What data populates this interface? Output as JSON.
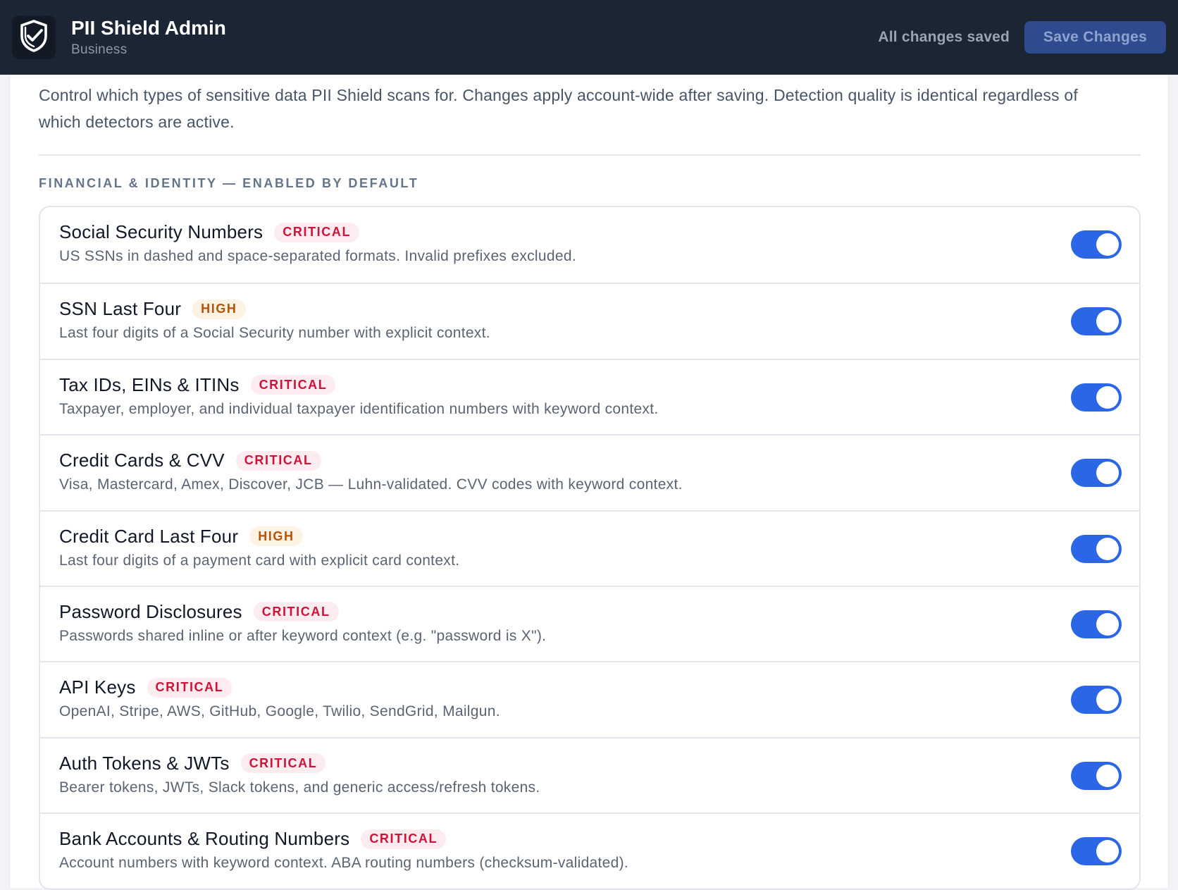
{
  "header": {
    "app_title": "PII Shield Admin",
    "plan_label": "Business",
    "logo_icon": "shield-check-icon",
    "save_status": "All changes saved",
    "save_button_label": "Save Changes"
  },
  "intro_text": "Control which types of sensitive data PII Shield scans for. Changes apply account-wide after saving. Detection quality is identical regardless of which detectors are active.",
  "section": {
    "heading": "FINANCIAL & IDENTITY — ENABLED BY DEFAULT",
    "detectors": [
      {
        "title": "Social Security Numbers",
        "badge": "CRITICAL",
        "severity": "critical",
        "description": "US SSNs in dashed and space-separated formats. Invalid prefixes excluded.",
        "enabled": true
      },
      {
        "title": "SSN Last Four",
        "badge": "HIGH",
        "severity": "high",
        "description": "Last four digits of a Social Security number with explicit context.",
        "enabled": true
      },
      {
        "title": "Tax IDs, EINs & ITINs",
        "badge": "CRITICAL",
        "severity": "critical",
        "description": "Taxpayer, employer, and individual taxpayer identification numbers with keyword context.",
        "enabled": true
      },
      {
        "title": "Credit Cards & CVV",
        "badge": "CRITICAL",
        "severity": "critical",
        "description": "Visa, Mastercard, Amex, Discover, JCB — Luhn-validated. CVV codes with keyword context.",
        "enabled": true
      },
      {
        "title": "Credit Card Last Four",
        "badge": "HIGH",
        "severity": "high",
        "description": "Last four digits of a payment card with explicit card context.",
        "enabled": true
      },
      {
        "title": "Password Disclosures",
        "badge": "CRITICAL",
        "severity": "critical",
        "description": "Passwords shared inline or after keyword context (e.g. \"password is X\").",
        "enabled": true
      },
      {
        "title": "API Keys",
        "badge": "CRITICAL",
        "severity": "critical",
        "description": "OpenAI, Stripe, AWS, GitHub, Google, Twilio, SendGrid, Mailgun.",
        "enabled": true
      },
      {
        "title": "Auth Tokens & JWTs",
        "badge": "CRITICAL",
        "severity": "critical",
        "description": "Bearer tokens, JWTs, Slack tokens, and generic access/refresh tokens.",
        "enabled": true
      },
      {
        "title": "Bank Accounts & Routing Numbers",
        "badge": "CRITICAL",
        "severity": "critical",
        "description": "Account numbers with keyword context. ABA routing numbers (checksum-validated).",
        "enabled": true
      }
    ]
  },
  "colors": {
    "header_bg": "#1b2533",
    "toggle_on": "#2a66e6",
    "critical": "#cf1239",
    "high": "#b45309"
  }
}
